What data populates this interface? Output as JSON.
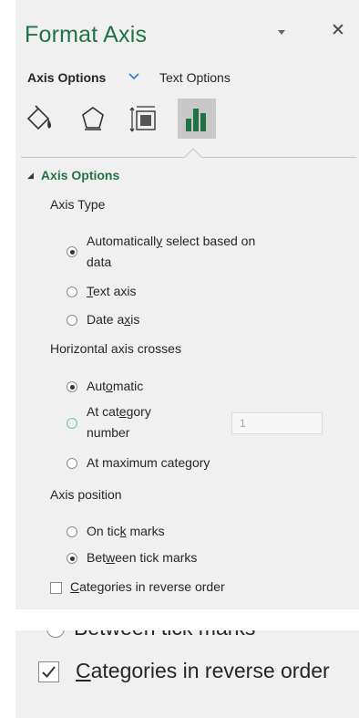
{
  "pane": {
    "title": "Format Axis",
    "tabs": {
      "axis_options": "Axis Options",
      "text_options": "Text Options"
    },
    "icons": [
      "fill-line-icon",
      "effects-icon",
      "size-properties-icon",
      "axis-options-icon"
    ]
  },
  "axis_options": {
    "section_title": "Axis Options",
    "axis_type": {
      "label": "Axis Type",
      "options": [
        {
          "pre": "Automaticall",
          "u": "y",
          "post": " select based on",
          "line2": "data",
          "selected": true
        },
        {
          "pre": "",
          "u": "T",
          "post": "ext axis",
          "selected": false
        },
        {
          "pre": "Date a",
          "u": "x",
          "post": "is",
          "selected": false
        }
      ]
    },
    "horizontal_crosses": {
      "label": "Horizontal axis crosses",
      "automatic": {
        "pre": "Aut",
        "u": "o",
        "post": "matic",
        "selected": true
      },
      "at_category": {
        "pre": "At cat",
        "u": "e",
        "post": "gory",
        "line2": "number",
        "selected": false,
        "value": "1"
      },
      "at_max": {
        "pre": "At maximum cate",
        "u": "g",
        "post": "ory",
        "selected": false
      }
    },
    "axis_position": {
      "label": "Axis position",
      "on_tick": {
        "pre": "On tic",
        "u": "k",
        "post": " marks",
        "selected": false
      },
      "between": {
        "pre": "Bet",
        "u": "w",
        "post": "een tick marks",
        "selected": true
      }
    },
    "reverse_order": {
      "u": "C",
      "post": "ategories in reverse order",
      "checked": false
    }
  },
  "zoom_inset": {
    "cut_text": "Between tick marks",
    "reverse_order": {
      "u": "C",
      "post": "ategories in reverse order",
      "checked": true
    }
  },
  "colors": {
    "accent": "#217346",
    "panel_bg": "#f0f0f0",
    "tab_chevron": "#2b7cd3"
  }
}
